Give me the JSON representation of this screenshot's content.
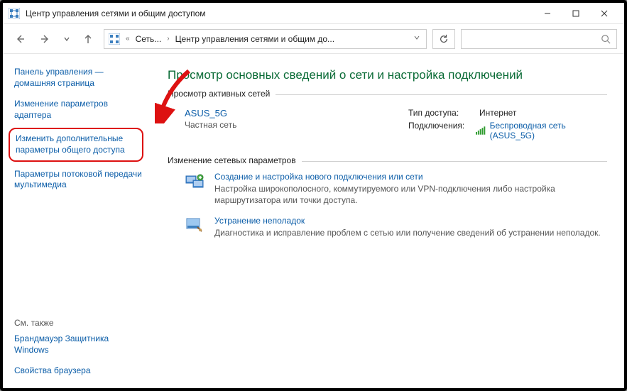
{
  "window": {
    "title": "Центр управления сетями и общим доступом"
  },
  "breadcrumb": {
    "item1": "Сеть...",
    "item2": "Центр управления сетями и общим до..."
  },
  "sidebar": {
    "link_home": "Панель управления — домашняя страница",
    "link_adapter": "Изменение параметров адаптера",
    "link_advanced": "Изменить дополнительные параметры общего доступа",
    "link_streaming": "Параметры потоковой передачи мультимедиа",
    "see_also_label": "См. также",
    "link_firewall": "Брандмауэр Защитника Windows",
    "link_browser": "Свойства браузера"
  },
  "main": {
    "heading": "Просмотр основных сведений о сети и настройка подключений",
    "active_networks_label": "Просмотр активных сетей",
    "network": {
      "name": "ASUS_5G",
      "subtitle": "Частная сеть",
      "access_label": "Тип доступа:",
      "access_value": "Интернет",
      "conn_label": "Подключения:",
      "conn_value": "Беспроводная сеть (ASUS_5G)"
    },
    "change_label": "Изменение сетевых параметров",
    "setup": {
      "link": "Создание и настройка нового подключения или сети",
      "desc": "Настройка широкополосного, коммутируемого или VPN-подключения либо настройка маршрутизатора или точки доступа."
    },
    "troubleshoot": {
      "link": "Устранение неполадок",
      "desc": "Диагностика и исправление проблем с сетью или получение сведений об устранении неполадок."
    }
  }
}
